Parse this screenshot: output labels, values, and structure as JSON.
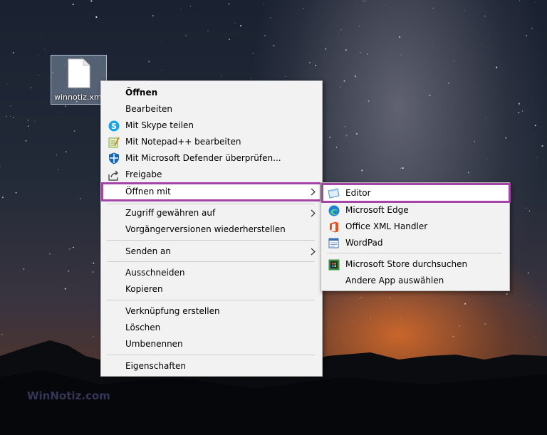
{
  "desktop": {
    "file_label": "winnotiz.xml",
    "watermark": "WinNotiz.com"
  },
  "context_menu": {
    "items": [
      {
        "label": "Öffnen",
        "icon": null
      },
      {
        "label": "Bearbeiten",
        "icon": null
      },
      {
        "label": "Mit Skype teilen",
        "icon": "skype-icon"
      },
      {
        "label": "Mit Notepad++ bearbeiten",
        "icon": "notepad-plus-plus-icon"
      },
      {
        "label": "Mit Microsoft Defender überprüfen...",
        "icon": "defender-icon"
      },
      {
        "label": "Freigabe",
        "icon": "share-icon"
      },
      {
        "label": "Öffnen mit",
        "icon": null,
        "submenu": true,
        "highlighted": true
      },
      {
        "label": "Zugriff gewähren auf",
        "icon": null,
        "submenu": true
      },
      {
        "label": "Vorgängerversionen wiederherstellen",
        "icon": null
      },
      {
        "label": "Senden an",
        "icon": null,
        "submenu": true
      },
      {
        "label": "Ausschneiden",
        "icon": null
      },
      {
        "label": "Kopieren",
        "icon": null
      },
      {
        "label": "Verknüpfung erstellen",
        "icon": null
      },
      {
        "label": "Löschen",
        "icon": null
      },
      {
        "label": "Umbenennen",
        "icon": null
      },
      {
        "label": "Eigenschaften",
        "icon": null
      }
    ]
  },
  "open_with_submenu": {
    "items": [
      {
        "label": "Editor",
        "icon": "notepad-icon",
        "highlighted": true
      },
      {
        "label": "Microsoft Edge",
        "icon": "edge-icon"
      },
      {
        "label": "Office XML Handler",
        "icon": "office-icon"
      },
      {
        "label": "WordPad",
        "icon": "wordpad-icon"
      },
      {
        "label": "Microsoft Store durchsuchen",
        "icon": "store-icon"
      },
      {
        "label": "Andere App auswählen",
        "icon": null
      }
    ]
  },
  "colors": {
    "highlight_border": "#a344a6",
    "menu_background": "#f2f2f2"
  }
}
